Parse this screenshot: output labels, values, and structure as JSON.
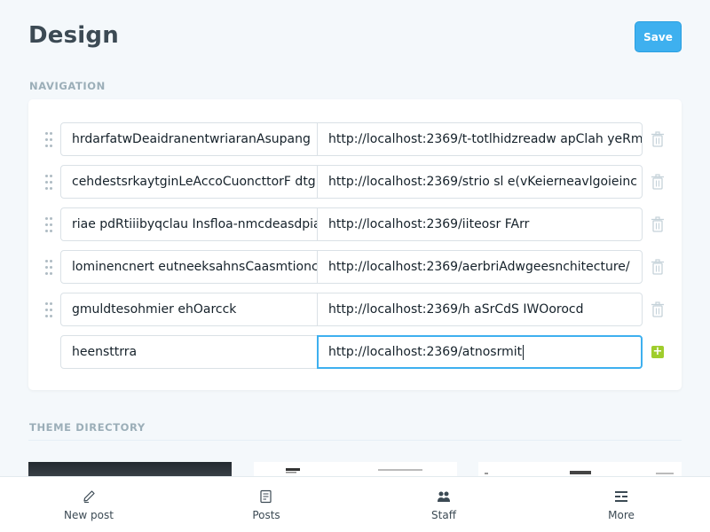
{
  "header": {
    "title": "Design",
    "save_label": "Save"
  },
  "navigation": {
    "section_label": "NAVIGATION",
    "items": [
      {
        "label": "hrdarfatwDeaidranentwriaranAsupang",
        "url": "http://localhost:2369/t-totlhidzreadw apClah yeRm"
      },
      {
        "label": "cehdestsrkaytginLeAccoCuoncttorF dtg",
        "url": "http://localhost:2369/strio sl e(vKeierneavlgoieinc"
      },
      {
        "label": "riae pdRtiiibyqclau Insfloa-nmcdeasdpia",
        "url": "http://localhost:2369/iiteosr FArr"
      },
      {
        "label": "lominencnert eutneeksahnsCaasmtionc",
        "url": "http://localhost:2369/aerbriAdwgeesnchitecture/"
      },
      {
        "label": "gmuldtesohmier ehOarcck",
        "url": "http://localhost:2369/h aSrCdS IWOorocd"
      }
    ],
    "new_item": {
      "label": "heensttrra",
      "url": "http://localhost:2369/atnosrmit"
    }
  },
  "theme_directory": {
    "section_label": "THEME DIRECTORY"
  },
  "tabbar": {
    "items": [
      {
        "label": "New post",
        "icon": "pen-icon"
      },
      {
        "label": "Posts",
        "icon": "posts-icon"
      },
      {
        "label": "Staff",
        "icon": "staff-icon"
      },
      {
        "label": "More",
        "icon": "more-icon"
      }
    ]
  },
  "colors": {
    "accent": "#3eb0ef",
    "add": "#9fcd2c",
    "title": "#3c4a54",
    "section": "#9baeb8"
  }
}
